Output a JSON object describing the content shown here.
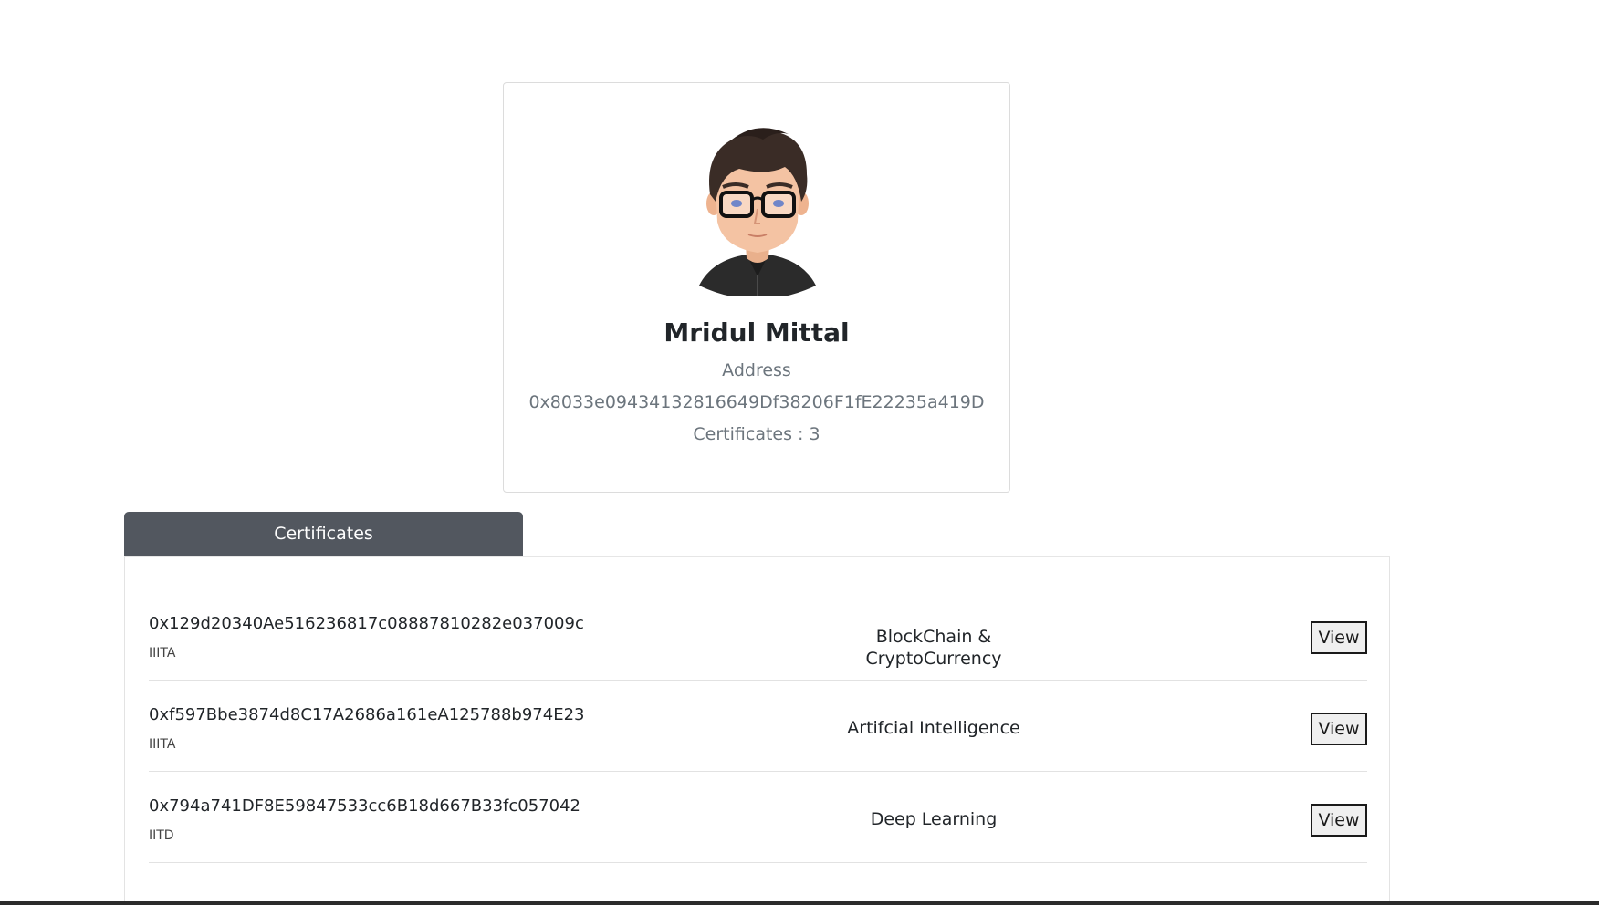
{
  "profile": {
    "name": "Mridul Mittal",
    "address_label": "Address",
    "address_value": "0x8033e09434132816649Df38206F1fE22235a419D",
    "certificates_count_text": "Certificates : 3"
  },
  "tabs": {
    "active_label": "Certificates"
  },
  "certificates": [
    {
      "hash": "0x129d20340Ae516236817c08887810282e037009c",
      "issuer": "IIITA",
      "course": "BlockChain & CryptoCurrency",
      "action": "View"
    },
    {
      "hash": "0xf597Bbe3874d8C17A2686a161eA125788b974E23",
      "issuer": "IIITA",
      "course": "Artifcial Intelligence",
      "action": "View"
    },
    {
      "hash": "0x794a741DF8E59847533cc6B18d667B33fc057042",
      "issuer": "IITD",
      "course": "Deep Learning",
      "action": "View"
    }
  ],
  "icons": {
    "avatar": "user-avatar-illustration"
  },
  "colors": {
    "tab_background": "#52575f",
    "muted_text": "#6c757d"
  }
}
